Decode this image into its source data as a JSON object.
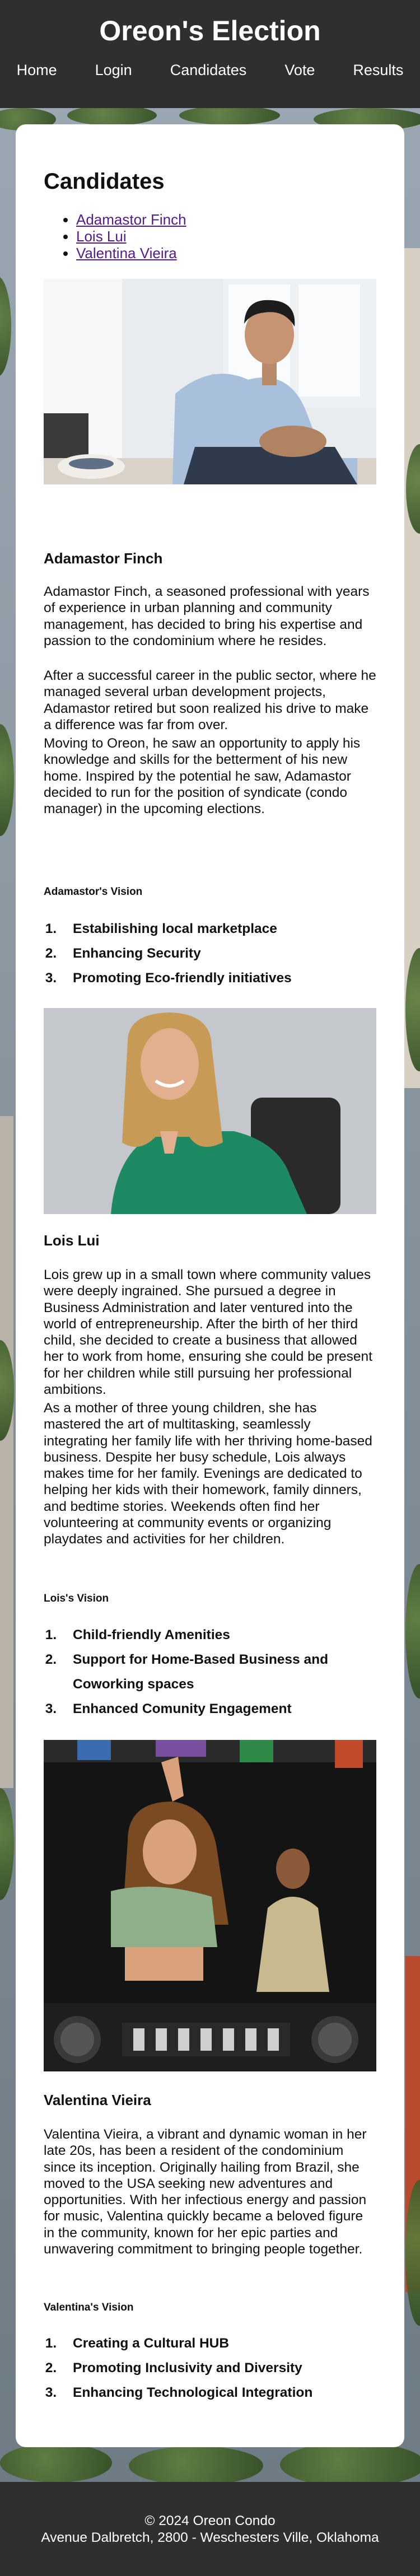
{
  "site": {
    "title": "Oreon's Election"
  },
  "nav": {
    "items": [
      {
        "label": "Home"
      },
      {
        "label": "Login"
      },
      {
        "label": "Candidates"
      },
      {
        "label": "Vote"
      },
      {
        "label": "Results"
      }
    ]
  },
  "main": {
    "heading": "Candidates",
    "toc": [
      {
        "label": "Adamastor Finch"
      },
      {
        "label": "Lois Lui"
      },
      {
        "label": "Valentina Vieira"
      }
    ]
  },
  "candidates": [
    {
      "name": "Adamastor Finch",
      "paragraphs": [
        "Adamastor Finch, a seasoned professional with years of experience in urban planning and community management, has decided to bring his expertise and passion to the condominium where he resides.",
        "After a successful career in the public sector, where he managed several urban development projects, Adamastor retired but soon realized his drive to make a difference was far from over.",
        "Moving to Oreon, he saw an opportunity to apply his knowledge and skills for the betterment of his new home. Inspired by the potential he saw, Adamastor decided to run for the position of syndicate (condo manager) in the upcoming elections."
      ],
      "vision_title": "Adamastor's Vision",
      "vision": [
        "Estabilishing local marketplace",
        "Enhancing Security",
        "Promoting Eco-friendly initiatives"
      ]
    },
    {
      "name": "Lois Lui",
      "paragraphs": [
        "Lois grew up in a small town where community values were deeply ingrained. She pursued a degree in Business Administration and later ventured into the world of entrepreneurship. After the birth of her third child, she decided to create a business that allowed her to work from home, ensuring she could be present for her children while still pursuing her professional ambitions.",
        "As a mother of three young children, she has mastered the art of multitasking, seamlessly integrating her family life with her thriving home-based business. Despite her busy schedule, Lois always makes time for her family. Evenings are dedicated to helping her kids with their homework, family dinners, and bedtime stories. Weekends often find her volunteering at community events or organizing playdates and activities for her children."
      ],
      "vision_title": "Lois's Vision",
      "vision": [
        "Child-friendly Amenities",
        "Support for Home-Based Business and Coworking spaces",
        "Enhanced Comunity Engagement"
      ]
    },
    {
      "name": "Valentina Vieira",
      "paragraphs": [
        "Valentina Vieira, a vibrant and dynamic woman in her late 20s, has been a resident of the condominium since its inception. Originally hailing from Brazil, she moved to the USA seeking new adventures and opportunities. With her infectious energy and passion for music, Valentina quickly became a beloved figure in the community, known for her epic parties and unwavering commitment to bringing people together."
      ],
      "vision_title": "Valentina's Vision",
      "vision": [
        "Creating a Cultural HUB",
        "Promoting Inclusivity and Diversity",
        "Enhancing Technological Integration"
      ]
    }
  ],
  "footer": {
    "copyright": "© 2024 Oreon Condo",
    "address": "Avenue Dalbretch, 2800 - Weschesters Ville, Oklahoma"
  }
}
